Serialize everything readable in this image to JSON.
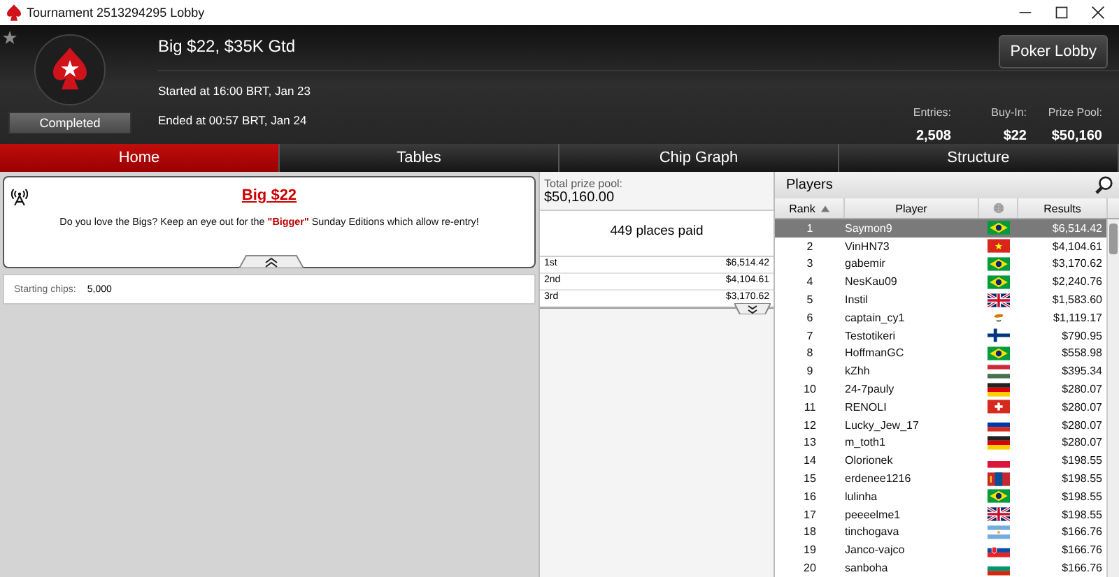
{
  "window": {
    "title": "Tournament 2513294295 Lobby"
  },
  "header": {
    "name": "Big $22, $35K Gtd",
    "status": "Completed",
    "started": "Started at 16:00 BRT, Jan 23",
    "ended": "Ended at 00:57 BRT, Jan 24",
    "lobby_button": "Poker Lobby",
    "stats": [
      {
        "label": "Entries:",
        "value": "2,508"
      },
      {
        "label": "Buy-In:",
        "value": "$22"
      },
      {
        "label": "Prize Pool:",
        "value": "$50,160"
      }
    ]
  },
  "tabs": [
    {
      "label": "Home",
      "selected": true
    },
    {
      "label": "Tables",
      "selected": false
    },
    {
      "label": "Chip Graph",
      "selected": false
    },
    {
      "label": "Structure",
      "selected": false
    }
  ],
  "announcement": {
    "title": "Big $22",
    "text": "Do you love the Bigs? Keep an eye out for the **\"Bigger\"** Sunday Editions which allow re-entry!"
  },
  "starting_chips": {
    "label": "Starting chips:",
    "value": "5,000"
  },
  "prizes": {
    "label": "Total prize pool:",
    "total": "$50,160.00",
    "places_paid": "449 places paid",
    "rows": [
      {
        "place": "1st",
        "amount": "$6,514.42"
      },
      {
        "place": "2nd",
        "amount": "$4,104.61"
      },
      {
        "place": "3rd",
        "amount": "$3,170.62"
      }
    ]
  },
  "players": {
    "title": "Players",
    "columns": [
      "Rank",
      "Player",
      "Results"
    ],
    "rows": [
      {
        "rank": "1",
        "player": "Saymon9",
        "kind": "br",
        "result": "$6,514.42",
        "selected": true
      },
      {
        "rank": "2",
        "player": "VinHN73",
        "kind": "vn",
        "result": "$4,104.61",
        "selected": false
      },
      {
        "rank": "3",
        "player": "gabemir",
        "kind": "br",
        "result": "$3,170.62",
        "selected": false
      },
      {
        "rank": "4",
        "player": "NesKau09",
        "kind": "br",
        "result": "$2,240.76",
        "selected": false
      },
      {
        "rank": "5",
        "player": "Instil",
        "kind": "gb",
        "result": "$1,583.60",
        "selected": false
      },
      {
        "rank": "6",
        "player": "captain_cy1",
        "kind": "cy",
        "result": "$1,119.17",
        "selected": false
      },
      {
        "rank": "7",
        "player": "Testotikeri",
        "kind": "fi",
        "result": "$790.95",
        "selected": false
      },
      {
        "rank": "8",
        "player": "HoffmanGC",
        "kind": "br",
        "result": "$558.98",
        "selected": false
      },
      {
        "rank": "9",
        "player": "kZhh",
        "kind": "hu",
        "result": "$395.34",
        "selected": false
      },
      {
        "rank": "10",
        "player": "24-7pauly",
        "kind": "de",
        "result": "$280.07",
        "selected": false
      },
      {
        "rank": "11",
        "player": "RENOLI",
        "kind": "ch",
        "result": "$280.07",
        "selected": false
      },
      {
        "rank": "12",
        "player": "Lucky_Jew_17",
        "kind": "ru",
        "result": "$280.07",
        "selected": false
      },
      {
        "rank": "13",
        "player": "m_toth1",
        "kind": "de",
        "result": "$280.07",
        "selected": false
      },
      {
        "rank": "14",
        "player": "Olorionek",
        "kind": "pl",
        "result": "$198.55",
        "selected": false
      },
      {
        "rank": "15",
        "player": "erdenee1216",
        "kind": "mn",
        "result": "$198.55",
        "selected": false
      },
      {
        "rank": "16",
        "player": "lulinha",
        "kind": "br",
        "result": "$198.55",
        "selected": false
      },
      {
        "rank": "17",
        "player": "peeeelme1",
        "kind": "gb",
        "result": "$198.55",
        "selected": false
      },
      {
        "rank": "18",
        "player": "tinchogava",
        "kind": "ar",
        "result": "$166.76",
        "selected": false
      },
      {
        "rank": "19",
        "player": "Janco-vajco",
        "kind": "sk",
        "result": "$166.76",
        "selected": false
      },
      {
        "rank": "20",
        "player": "sanboha",
        "kind": "bg",
        "result": "$166.76",
        "selected": false
      }
    ]
  }
}
